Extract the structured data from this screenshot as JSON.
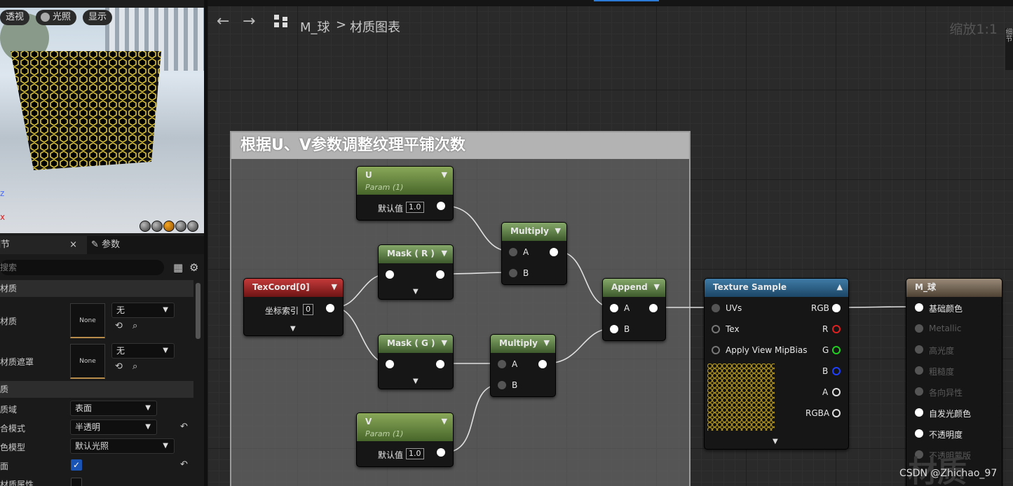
{
  "viewport": {
    "buttons": [
      "透视",
      "光照",
      "显示"
    ],
    "axis_z": "z",
    "axis_x": "x"
  },
  "details": {
    "tab_label": "细节",
    "tab_close": "×",
    "tab2_label": "参数",
    "search_placeholder": "搜索",
    "sections": [
      "材质",
      "质"
    ],
    "rows": [
      {
        "label": "材质",
        "thumb": "None",
        "combo": "无"
      },
      {
        "label": "材质遮罩",
        "thumb": "None",
        "combo": "无"
      }
    ],
    "props": [
      {
        "label": "质域",
        "value": "表面"
      },
      {
        "label": "合模式",
        "value": "半透明"
      },
      {
        "label": "色模型",
        "value": "默认光照"
      },
      {
        "label": "面",
        "value": ""
      },
      {
        "label": "材质属性",
        "value": ""
      }
    ]
  },
  "toolbar": {
    "material": "M_球",
    "separator": ">",
    "graph": "材质图表",
    "zoom": "缩放1:1",
    "side": "细节"
  },
  "comment": {
    "title": "根据U、V参数调整纹理平铺次数"
  },
  "nodes": {
    "u": {
      "title": "U",
      "sub": "Param (1)",
      "label": "默认值",
      "value": "1.0"
    },
    "v": {
      "title": "V",
      "sub": "Param (1)",
      "label": "默认值",
      "value": "1.0"
    },
    "texcoord": {
      "title": "TexCoord[0]",
      "label": "坐标索引",
      "value": "0"
    },
    "maskr": {
      "title": "Mask ( R )"
    },
    "maskg": {
      "title": "Mask ( G )"
    },
    "mul1": {
      "title": "Multiply",
      "a": "A",
      "b": "B"
    },
    "mul2": {
      "title": "Multiply",
      "a": "A",
      "b": "B"
    },
    "append": {
      "title": "Append",
      "a": "A",
      "b": "B"
    },
    "tex": {
      "title": "Texture Sample",
      "inputs": [
        "UVs",
        "Tex",
        "Apply View MipBias"
      ],
      "outputs": [
        "RGB",
        "R",
        "G",
        "B",
        "A",
        "RGBA"
      ]
    },
    "result": {
      "title": "M_球",
      "pins": [
        "基础颜色",
        "Metallic",
        "高光度",
        "粗糙度",
        "各向异性",
        "自发光颜色",
        "不透明度",
        "不透明蒙版"
      ]
    }
  },
  "watermark": "CSDN @Zhichao_97",
  "bg_text": "材质"
}
